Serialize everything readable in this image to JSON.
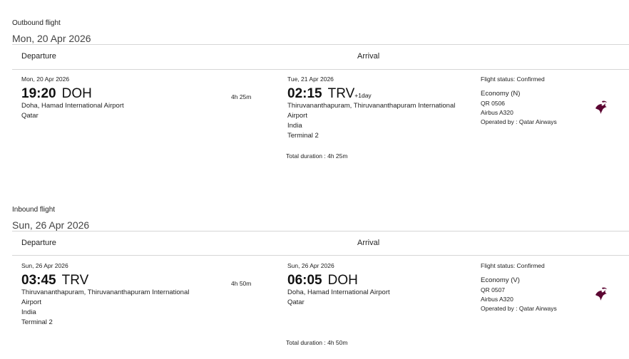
{
  "outbound": {
    "label": "Outbound flight",
    "date": "Mon, 20 Apr 2026",
    "departure_header": "Departure",
    "arrival_header": "Arrival",
    "departure": {
      "date": "Mon, 20 Apr 2026",
      "time": "19:20",
      "code": "DOH",
      "airport_lines": [
        "Doha, Hamad International Airport",
        "Qatar"
      ]
    },
    "duration": "4h 25m",
    "arrival": {
      "date": "Tue, 21 Apr 2026",
      "time": "02:15",
      "code": "TRV",
      "day_offset": "+1day",
      "airport_lines": [
        "Thiruvananthapuram, Thiruvananthapuram International",
        "Airport",
        "India",
        "Terminal 2"
      ]
    },
    "total_duration": "Total duration : 4h 25m",
    "flight_status": "Flight status: Confirmed",
    "cabin": "Economy (N)",
    "flight_number": "QR 0506",
    "aircraft": "Airbus A320",
    "operated_by": "Operated by : Qatar Airways",
    "airline_logo_icon": "qatar-airways-oryx-logo"
  },
  "inbound": {
    "label": "Inbound flight",
    "date": "Sun, 26 Apr 2026",
    "departure_header": "Departure",
    "arrival_header": "Arrival",
    "departure": {
      "date": "Sun, 26 Apr 2026",
      "time": "03:45",
      "code": "TRV",
      "airport_lines": [
        "Thiruvananthapuram, Thiruvananthapuram International",
        "Airport",
        "India",
        "Terminal 2"
      ]
    },
    "duration": "4h 50m",
    "arrival": {
      "date": "Sun, 26 Apr 2026",
      "time": "06:05",
      "code": "DOH",
      "airport_lines": [
        "Doha, Hamad International Airport",
        "Qatar"
      ]
    },
    "total_duration": "Total duration : 4h 50m",
    "flight_status": "Flight status: Confirmed",
    "cabin": "Economy (V)",
    "flight_number": "QR 0507",
    "aircraft": "Airbus A320",
    "operated_by": "Operated by : Qatar Airways",
    "airline_logo_icon": "qatar-airways-oryx-logo"
  },
  "colors": {
    "logo": "#5c0632",
    "rule": "#d6d6d6"
  }
}
